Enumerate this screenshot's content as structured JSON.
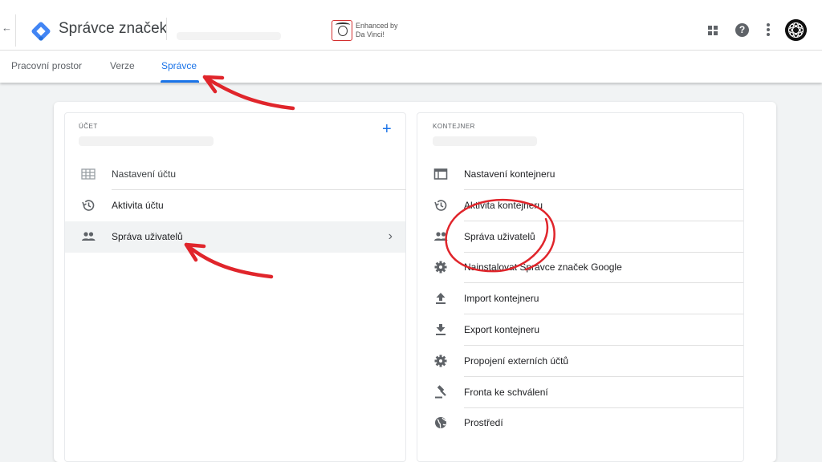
{
  "header": {
    "back_icon": "arrow-back-icon",
    "app_title": "Správce značek",
    "extension_text_line1": "Enhanced by",
    "extension_text_line2": "Da Vinci!"
  },
  "tabs": [
    {
      "label": "Pracovní prostor"
    },
    {
      "label": "Verze"
    },
    {
      "label": "Správce",
      "active": true
    }
  ],
  "account_section": {
    "heading": "ÚČET",
    "add_icon": "+",
    "items": [
      {
        "label": "Nastavení účtu",
        "icon": "table-icon"
      },
      {
        "label": "Aktivita účtu",
        "icon": "history-icon"
      },
      {
        "label": "Správa uživatelů",
        "icon": "people-icon",
        "selected": true
      }
    ]
  },
  "container_section": {
    "heading": "KONTEJNER",
    "items": [
      {
        "label": "Nastavení kontejneru",
        "icon": "web-icon"
      },
      {
        "label": "Aktivita kontejneru",
        "icon": "history-icon"
      },
      {
        "label": "Správa uživatelů",
        "icon": "people-icon"
      },
      {
        "label": "Nainstalovat Správce značek Google",
        "icon": "gear-icon"
      },
      {
        "label": "Import kontejneru",
        "icon": "upload-icon"
      },
      {
        "label": "Export kontejneru",
        "icon": "download-icon"
      },
      {
        "label": "Propojení externích účtů",
        "icon": "gear-icon"
      },
      {
        "label": "Fronta ke schválení",
        "icon": "gavel-icon"
      },
      {
        "label": "Prostředí",
        "icon": "globe-icon"
      }
    ]
  },
  "colors": {
    "accent": "#1a73e8",
    "annotation_red": "#e0252b"
  }
}
